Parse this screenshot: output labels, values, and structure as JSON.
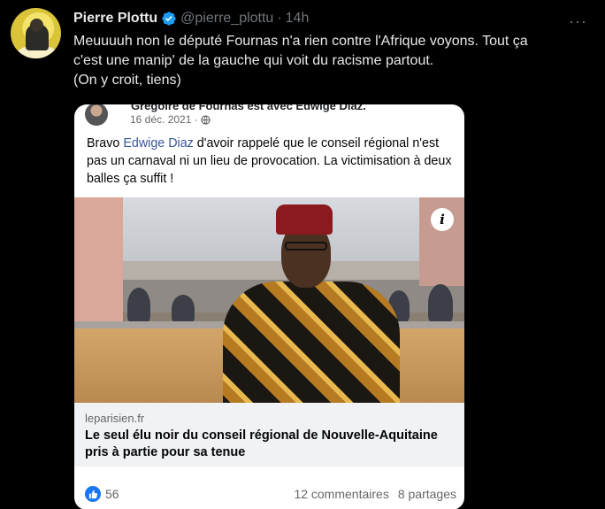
{
  "tweet": {
    "author_name": "Pierre Plottu",
    "handle": "@pierre_plottu",
    "separator": "·",
    "time": "14h",
    "more_label": "···",
    "text_lines": [
      "Meuuuuh non le député Fournas n'a rien contre l'Afrique voyons. Tout ça",
      "c'est une manip' de la gauche qui voit du racisme partout.",
      "(On y croit, tiens)"
    ]
  },
  "fb_post": {
    "author_cut": "Grégoire de Fournas est avec Edwige Diaz.",
    "date": "16 déc. 2021 ·",
    "text_before": "Bravo ",
    "mention": "Edwige Diaz",
    "text_after": " d'avoir rappelé que le conseil régional n'est pas un carnaval ni un lieu de provocation. La victimisation à deux balles ça suffit !",
    "info_label": "i",
    "link_domain": "leparisien.fr",
    "link_title": "Le seul élu noir du conseil régional de Nouvelle-Aquitaine pris à partie pour sa tenue",
    "likes": "56",
    "comments": "12 commentaires",
    "shares": "8 partages"
  },
  "colors": {
    "background": "#000000",
    "text_primary": "#e7e9ea",
    "text_secondary": "#71767b",
    "verified_blue": "#1d9bf0",
    "fb_link": "#385898",
    "fb_like_blue": "#1877f2"
  },
  "icons": {
    "verified": "verified-badge-icon",
    "more": "more-horizontal-icon",
    "globe": "globe-icon",
    "info": "info-icon",
    "like": "thumbs-up-icon"
  }
}
